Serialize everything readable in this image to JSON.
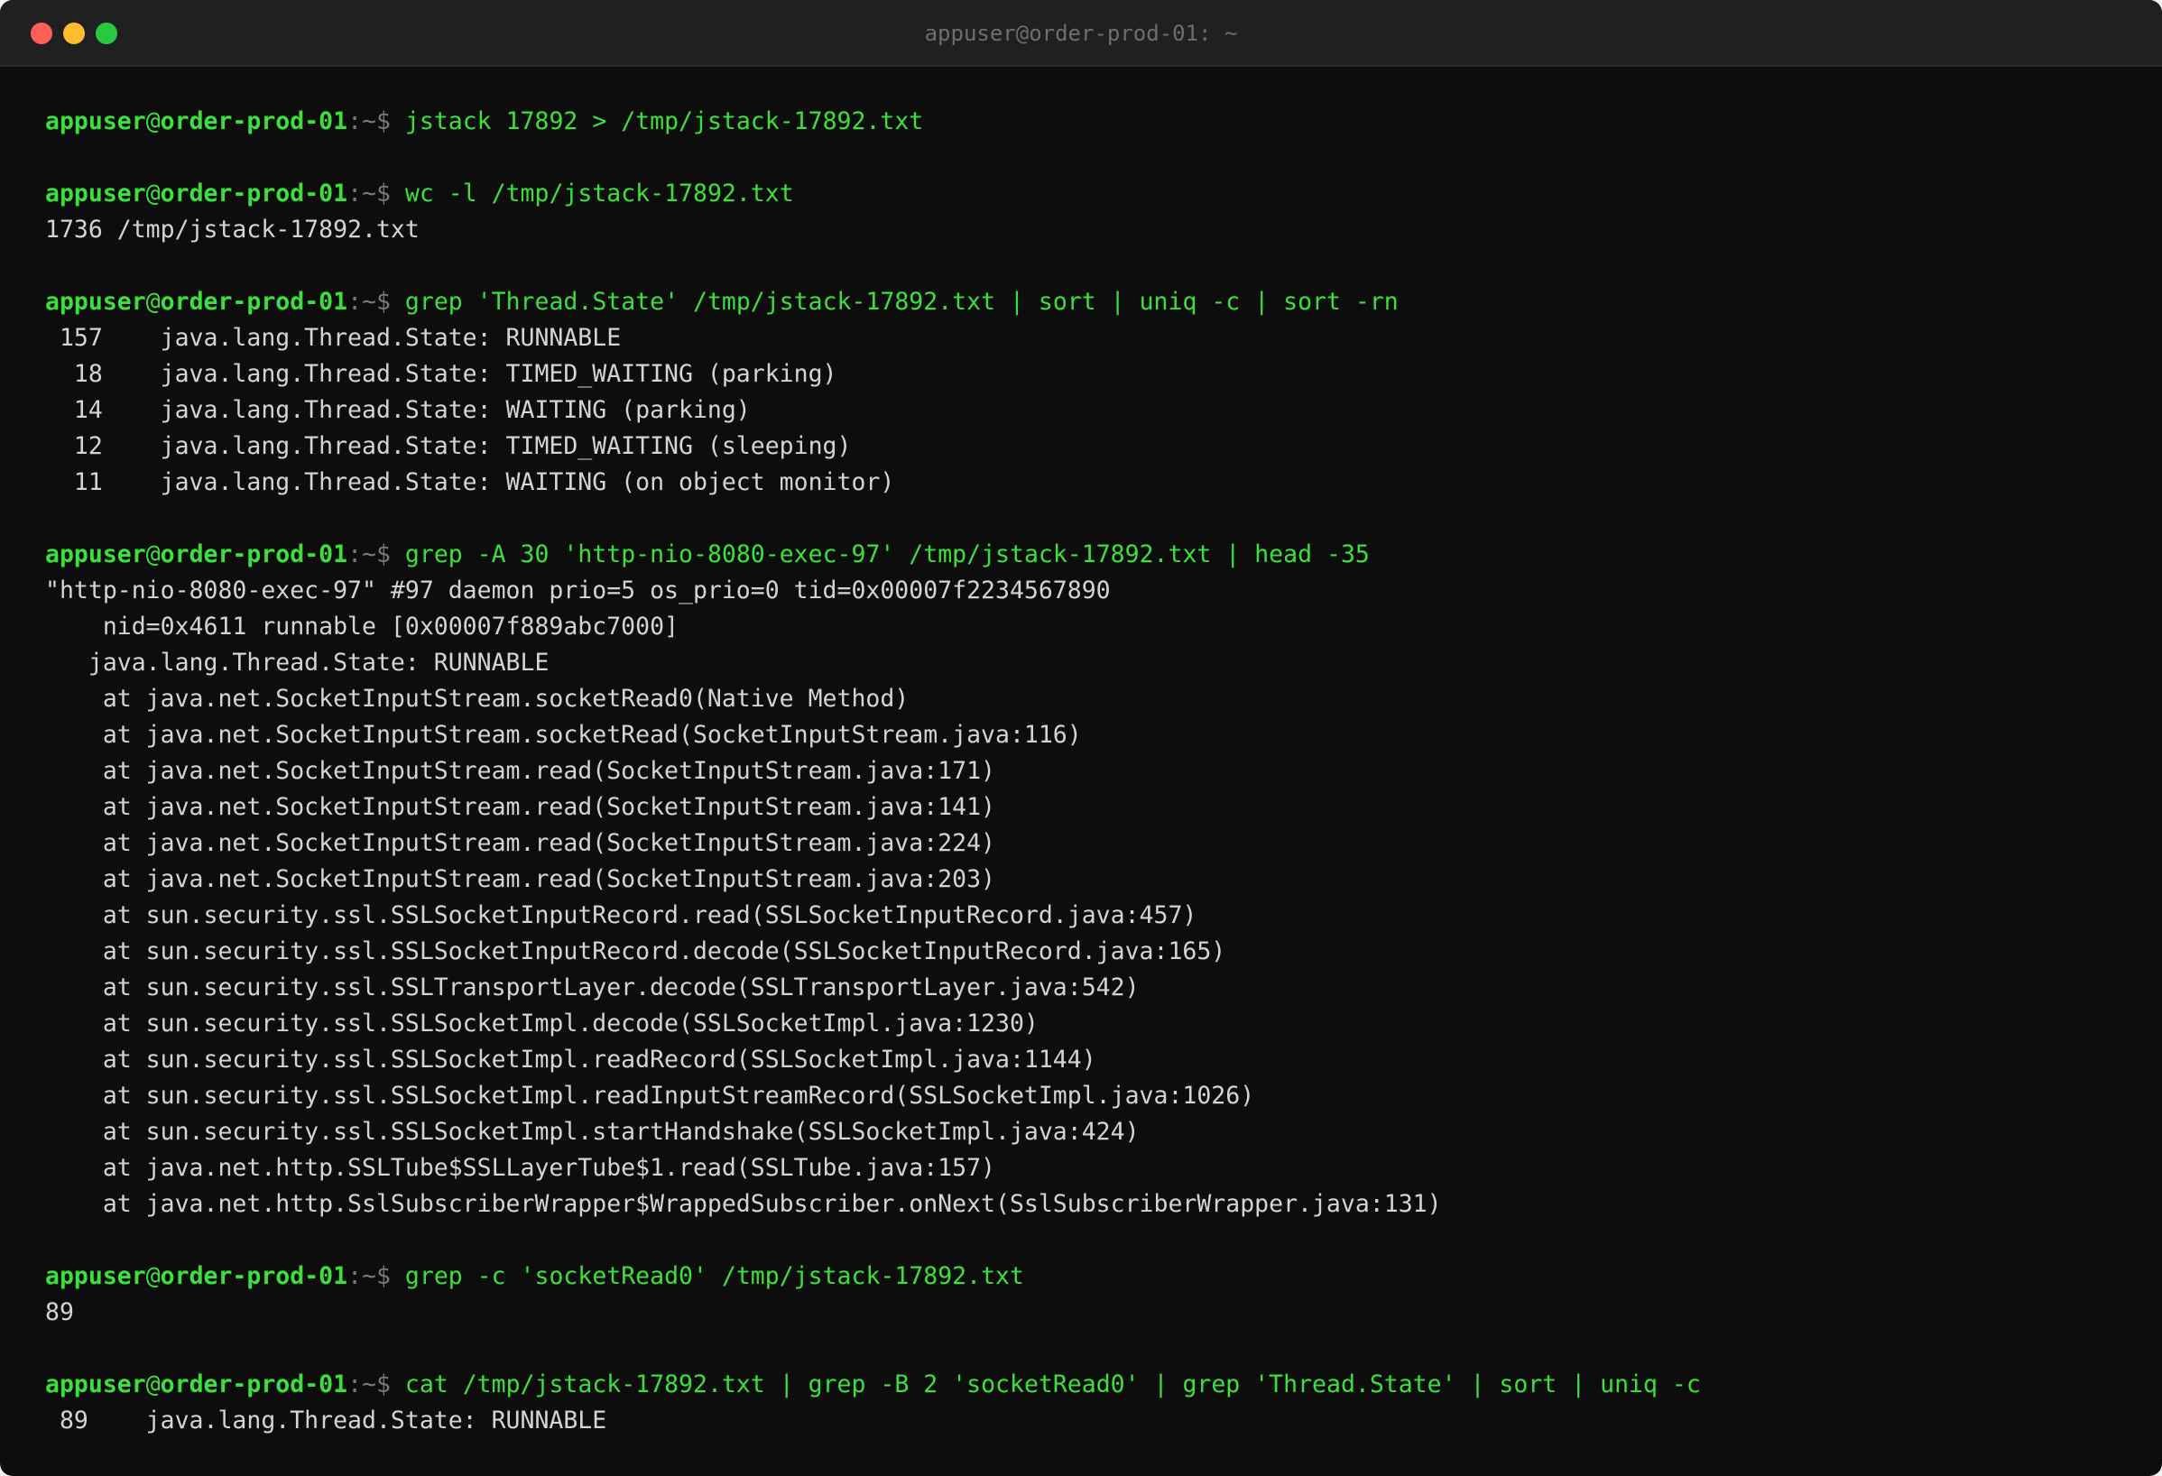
{
  "window": {
    "title": "appuser@order-prod-01: ~"
  },
  "prompt": {
    "user": "appuser",
    "at": "@",
    "host": "order-prod-01",
    "sep": ":~$ "
  },
  "blocks": [
    {
      "command": "jstack 17892 > /tmp/jstack-17892.txt",
      "output": []
    },
    {
      "command": "wc -l /tmp/jstack-17892.txt",
      "output": [
        "1736 /tmp/jstack-17892.txt"
      ]
    },
    {
      "command": "grep 'Thread.State' /tmp/jstack-17892.txt | sort | uniq -c | sort -rn",
      "output": [
        " 157    java.lang.Thread.State: RUNNABLE",
        "  18    java.lang.Thread.State: TIMED_WAITING (parking)",
        "  14    java.lang.Thread.State: WAITING (parking)",
        "  12    java.lang.Thread.State: TIMED_WAITING (sleeping)",
        "  11    java.lang.Thread.State: WAITING (on object monitor)"
      ]
    },
    {
      "command": "grep -A 30 'http-nio-8080-exec-97' /tmp/jstack-17892.txt | head -35",
      "output": [
        "\"http-nio-8080-exec-97\" #97 daemon prio=5 os_prio=0 tid=0x00007f2234567890",
        "    nid=0x4611 runnable [0x00007f889abc7000]",
        "   java.lang.Thread.State: RUNNABLE",
        "    at java.net.SocketInputStream.socketRead0(Native Method)",
        "    at java.net.SocketInputStream.socketRead(SocketInputStream.java:116)",
        "    at java.net.SocketInputStream.read(SocketInputStream.java:171)",
        "    at java.net.SocketInputStream.read(SocketInputStream.java:141)",
        "    at java.net.SocketInputStream.read(SocketInputStream.java:224)",
        "    at java.net.SocketInputStream.read(SocketInputStream.java:203)",
        "    at sun.security.ssl.SSLSocketInputRecord.read(SSLSocketInputRecord.java:457)",
        "    at sun.security.ssl.SSLSocketInputRecord.decode(SSLSocketInputRecord.java:165)",
        "    at sun.security.ssl.SSLTransportLayer.decode(SSLTransportLayer.java:542)",
        "    at sun.security.ssl.SSLSocketImpl.decode(SSLSocketImpl.java:1230)",
        "    at sun.security.ssl.SSLSocketImpl.readRecord(SSLSocketImpl.java:1144)",
        "    at sun.security.ssl.SSLSocketImpl.readInputStreamRecord(SSLSocketImpl.java:1026)",
        "    at sun.security.ssl.SSLSocketImpl.startHandshake(SSLSocketImpl.java:424)",
        "    at java.net.http.SSLTube$SSLLayerTube$1.read(SSLTube.java:157)",
        "    at java.net.http.SslSubscriberWrapper$WrappedSubscriber.onNext(SslSubscriberWrapper.java:131)"
      ]
    },
    {
      "command": "grep -c 'socketRead0' /tmp/jstack-17892.txt",
      "output": [
        "89"
      ]
    },
    {
      "command": "cat /tmp/jstack-17892.txt | grep -B 2 'socketRead0' | grep 'Thread.State' | sort | uniq -c",
      "output": [
        " 89    java.lang.Thread.State: RUNNABLE"
      ]
    }
  ]
}
